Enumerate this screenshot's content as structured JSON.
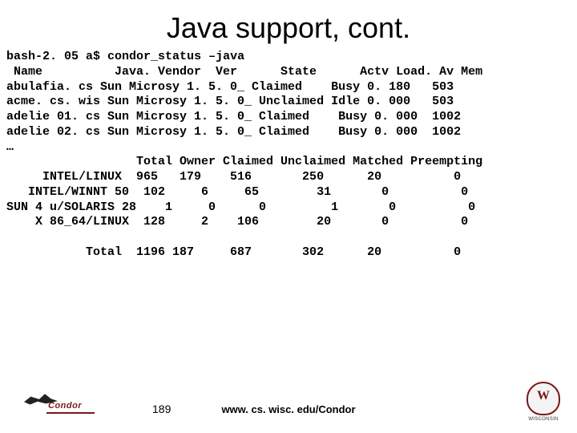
{
  "title": "Java support, cont.",
  "terminal": {
    "prompt": "bash-2. 05 a$",
    "command": "condor_status –java",
    "header": " Name          Java. Vendor  Ver      State      Actv Load. Av Mem",
    "rows": [
      "abulafia. cs Sun Microsy 1. 5. 0_ Claimed    Busy 0. 180   503",
      "acme. cs. wis Sun Microsy 1. 5. 0_ Unclaimed Idle 0. 000   503",
      "adelie 01. cs Sun Microsy 1. 5. 0_ Claimed    Busy 0. 000  1002",
      "adelie 02. cs Sun Microsy 1. 5. 0_ Claimed    Busy 0. 000  1002"
    ],
    "ellipsis": "…",
    "summary_header": "                  Total Owner Claimed Unclaimed Matched Preempting",
    "summary_rows": [
      "     INTEL/LINUX  965   179    516       250      20          0",
      "   INTEL/WINNT 50  102     6     65        31       0          0",
      "SUN 4 u/SOLARIS 28    1     0      0         1       0          0",
      "    X 86_64/LINUX  128     2    106        20       0          0"
    ],
    "total_row": "           Total  1196 187     687       302      20          0"
  },
  "footer": {
    "condor_label": "Condor",
    "page_number": "189",
    "url": "www. cs. wisc. edu/Condor",
    "wisc_letter": "W",
    "wisc_label": "WISCONSIN"
  }
}
